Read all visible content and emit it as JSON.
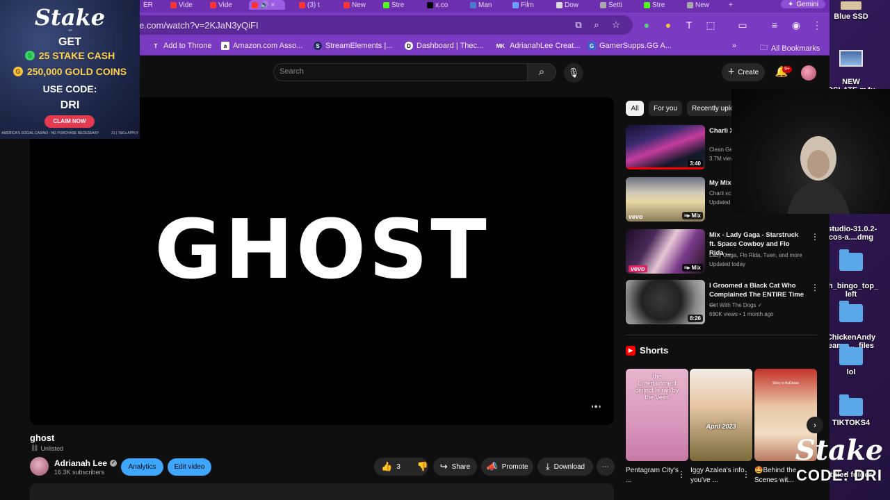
{
  "desktop": {
    "icons": [
      {
        "name": "desktop-icon-blue-ssd",
        "label": "Blue SSD"
      },
      {
        "name": "desktop-icon-new-slate",
        "label": "NEW\nOSLATE.m4v"
      },
      {
        "name": "desktop-icon-studio-dmg",
        "label": "-studio-31.0.2-\ncos-a....dmg"
      },
      {
        "name": "desktop-icon-bingo",
        "label": "ch_bingo_top_\nleft"
      },
      {
        "name": "desktop-icon-chickenandy",
        "label": "ChickenAndy\neam -..._files"
      },
      {
        "name": "desktop-icon-lol",
        "label": "lol"
      },
      {
        "name": "desktop-icon-tiktoks",
        "label": "TIKTOKS4"
      },
      {
        "name": "desktop-icon-untitled",
        "label": "titled folder"
      }
    ]
  },
  "browser": {
    "tabs": [
      "ER",
      "Vide",
      "Vide",
      "",
      "(3) t",
      "New",
      "Stre",
      "x.co",
      "Man",
      "Film",
      "Dow",
      "Setti",
      "Stre",
      "New"
    ],
    "gemini_label": "Gemini",
    "url": "e.com/watch?v=2KJaN3yQiFI",
    "bookmarks": [
      {
        "icon": "s",
        "label": "s"
      },
      {
        "icon": "T",
        "label": "Add to Throne"
      },
      {
        "icon": "a",
        "label": "Amazon.com Asso..."
      },
      {
        "icon": "S",
        "label": "StreamElements |..."
      },
      {
        "icon": "D",
        "label": "Dashboard | Thec..."
      },
      {
        "icon": "MK",
        "label": "AdrianahLee Creat..."
      },
      {
        "icon": "G",
        "label": "GamerSupps.GG A..."
      }
    ],
    "all_bookmarks": "All Bookmarks"
  },
  "youtube": {
    "search_placeholder": "Search",
    "create_label": "Create",
    "notification_count": "9+",
    "video": {
      "screen_text": "GHOST",
      "title": "ghost",
      "visibility": "Unlisted",
      "channel": "Adrianah Lee",
      "subscribers": "16.3K subscribers",
      "analytics_label": "Analytics",
      "edit_label": "Edit video",
      "likes": "3",
      "share_label": "Share",
      "promote_label": "Promote",
      "download_label": "Download"
    },
    "chips": [
      "All",
      "For you",
      "Recently uploaded"
    ],
    "recommendations": [
      {
        "title": "Charli XCX - Off Along",
        "meta1": "Clean Genie",
        "meta2": "3.7M views",
        "duration": "3:40",
        "badge": ""
      },
      {
        "title": "My Mix",
        "meta1": "Charli xcx",
        "meta2": "Updated",
        "duration": "",
        "badge": "Mix"
      },
      {
        "title": "Mix - Lady Gaga - Starstruck ft. Space Cowboy and Flo Rida ...",
        "meta1": "Lady Gaga, Flo Rida, Tuen, and more",
        "meta2": "Updated today",
        "duration": "",
        "badge": "Mix"
      },
      {
        "title": "I Groomed a Black Cat Who Complained The ENTIRE Time ...",
        "meta1": "Girl With The Dogs",
        "meta2": "690K views • 1 month ago",
        "duration": "8:26",
        "badge": ""
      }
    ],
    "shorts_title": "Shorts",
    "shorts": [
      {
        "caption": "Pentagram City's ...",
        "overlay": "the Entertainment district is ran by the Vees"
      },
      {
        "caption": "Iggy Azalea's info you've ...",
        "overlay": "April 2023"
      },
      {
        "caption": "🤩Behind the Scenes wit...",
        "overlay": "Story w AuDaxas"
      }
    ]
  },
  "stake_ad": {
    "logo": "Stake",
    "logo_sub": ".us",
    "get": "GET",
    "line1": "25 STAKE CASH",
    "line2": "250,000 GOLD COINS",
    "use_code": "USE CODE:",
    "code": "DRI",
    "claim": "CLAIM NOW",
    "fine_left": "AMERICA'S SOCIAL CASINO · NO PURCHASE NECESSARY",
    "fine_right": "21 | T&Cs APPLY"
  },
  "stake_corner": {
    "logo": "Stake",
    "code": "CODE: DRI"
  }
}
